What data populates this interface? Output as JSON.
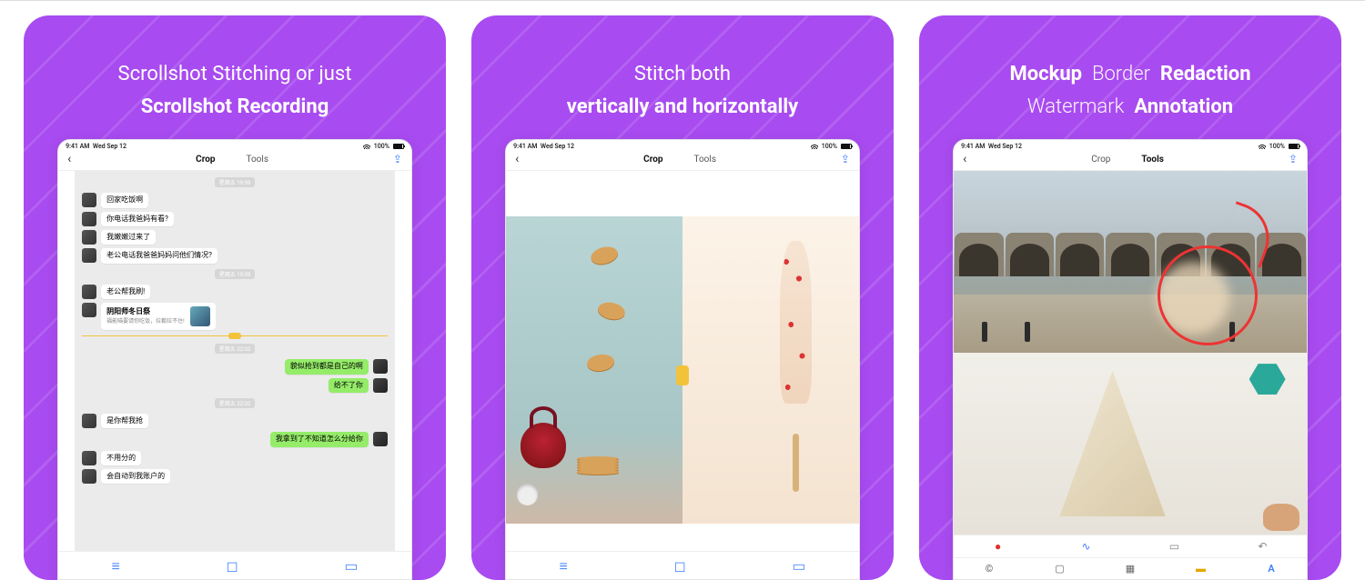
{
  "statusbar": {
    "time": "9:41 AM",
    "date": "Wed Sep 12",
    "battery": "100%"
  },
  "nav": {
    "crop": "Crop",
    "tools": "Tools"
  },
  "cards": [
    {
      "line1": "Scrollshot Stitching or just",
      "line2": "Scrollshot Recording",
      "chat": {
        "t1": "星期五 19:59",
        "m1": "回家吃饭啊",
        "m2": "你电话我爸妈有看?",
        "m3": "我嫩嫩过来了",
        "m4": "老公电话我爸爸妈妈问他们情况?",
        "t2": "星期五 19:59",
        "m5": "老公帮我刷!",
        "m6_title": "阴阳师冬日祭",
        "m6_sub": "福能喵要请你吃饭，拉都拉不住!",
        "t3": "星期五 22:02",
        "m7": "貌似抢到都是自己的啊",
        "m8": "给不了你",
        "t4": "星期五 22:02",
        "m9": "是你帮我抢",
        "m10": "我拿到了不知道怎么分给你",
        "m11": "不用分的",
        "m12": "会自动到我账户的"
      }
    },
    {
      "line1": "Stitch both",
      "line2": "vertically and horizontally"
    },
    {
      "row1_a": "Mockup",
      "row1_b": "Border",
      "row1_c": "Redaction",
      "row2_a": "Watermark",
      "row2_b": "Annotation",
      "tool_copyright": "©",
      "tool_text": "A"
    }
  ]
}
